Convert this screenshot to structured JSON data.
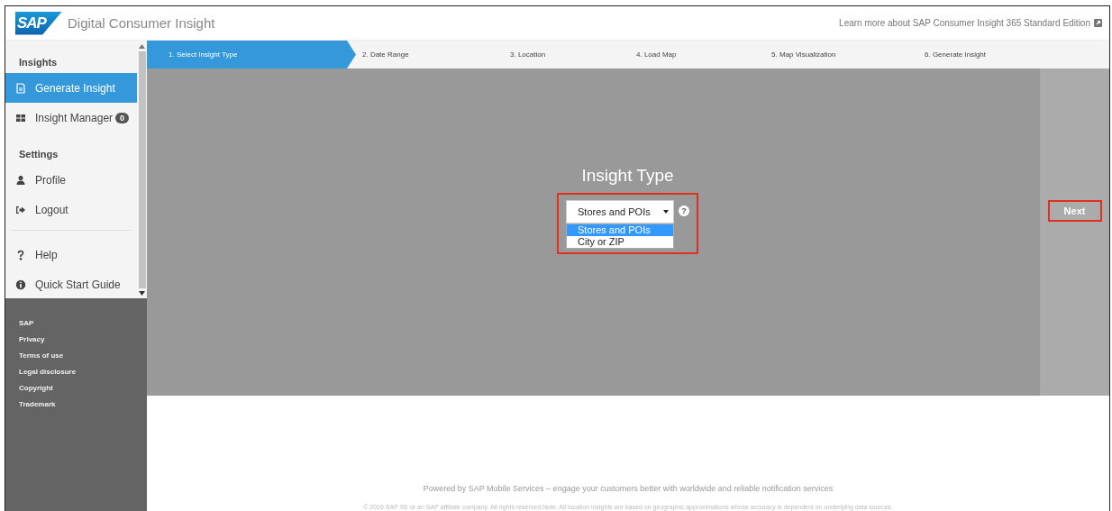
{
  "header": {
    "logo": "SAP",
    "title": "Digital Consumer Insight",
    "learn_more": "Learn more about SAP Consumer Insight 365 Standard Edition"
  },
  "sidebar": {
    "sections": [
      {
        "heading": "Insights",
        "items": [
          {
            "label": "Generate Insight",
            "selected": true
          },
          {
            "label": "Insight Manager",
            "badge": "0",
            "selected": false
          }
        ]
      },
      {
        "heading": "Settings",
        "items": [
          {
            "label": "Profile",
            "selected": false
          },
          {
            "label": "Logout",
            "selected": false
          }
        ]
      },
      {
        "items": [
          {
            "label": "Help",
            "selected": false
          },
          {
            "label": "Quick Start Guide",
            "selected": false
          }
        ]
      }
    ],
    "links": [
      "SAP",
      "Privacy",
      "Terms of use",
      "Legal disclosure",
      "Copyright",
      "Trademark"
    ]
  },
  "steps": [
    {
      "label": "1. Select Insight Type",
      "selected": true
    },
    {
      "label": "2. Date Range",
      "selected": false
    },
    {
      "label": "3. Location",
      "selected": false
    },
    {
      "label": "4. Load Map",
      "selected": false
    },
    {
      "label": "5. Map Visualization",
      "selected": false
    },
    {
      "label": "6. Generate Insight",
      "selected": false
    }
  ],
  "insight_type": {
    "title": "Insight Type",
    "select": {
      "value": "Stores and POIs",
      "expanded": true,
      "options": [
        {
          "label": "Stores and POIs",
          "selected": true
        },
        {
          "label": "City or ZIP",
          "selected": false
        }
      ]
    },
    "help": "?"
  },
  "next_button": "Next",
  "footer": {
    "powered_by": "Powered by SAP Mobile Services – engage your customers better with worldwide and reliable notification services",
    "copyright": "© 2016 SAP SE or an SAP affiliate company. All rights reserved.Note: All location insights are based on geographic approximations whose accuracy is dependent on underlying data sources."
  }
}
